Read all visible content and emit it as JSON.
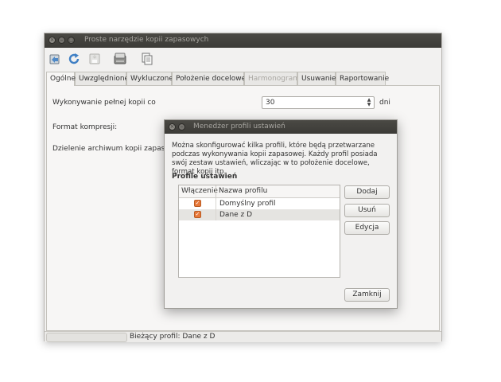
{
  "main": {
    "title": "Proste narzędzie kopii zapasowych",
    "tabs": [
      {
        "label": "Ogólne"
      },
      {
        "label": "Uwzględnione"
      },
      {
        "label": "Wykluczone"
      },
      {
        "label": "Położenie docelowe"
      },
      {
        "label": "Harmonogram"
      },
      {
        "label": "Usuwanie"
      },
      {
        "label": "Raportowanie"
      }
    ],
    "form": {
      "full_backup_label": "Wykonywanie pełnej kopii co",
      "full_backup_value": "30",
      "full_backup_unit": "dni",
      "compression_label": "Format kompresji:",
      "split_label": "Dzielenie archiwum kopii zapasowe"
    },
    "status": "Bieżący profil: Dane z D"
  },
  "dialog": {
    "title": "Menedżer profili ustawień",
    "description": "Można skonfigurować kilka profili, które będą przetwarzane podczas wykonywania kopii zapasowej. Każdy profil posiada swój zestaw ustawień, wliczając w to położenie docelowe, format kopii itp.",
    "section": "Profile ustawień",
    "columns": {
      "enabled": "Włączenie",
      "name": "Nazwa profilu"
    },
    "profiles": [
      {
        "name": "Domyślny profil",
        "enabled": true
      },
      {
        "name": "Dane z D",
        "enabled": true
      }
    ],
    "buttons": {
      "add": "Dodaj",
      "remove": "Usuń",
      "edit": "Edycja",
      "close": "Zamknij"
    }
  },
  "icons": [
    "open-icon",
    "refresh-icon",
    "save-icon",
    "backup-icon",
    "copy-icon"
  ],
  "colors": {
    "titlebar": "#3c3b37",
    "checkbox": "#e8793a"
  }
}
